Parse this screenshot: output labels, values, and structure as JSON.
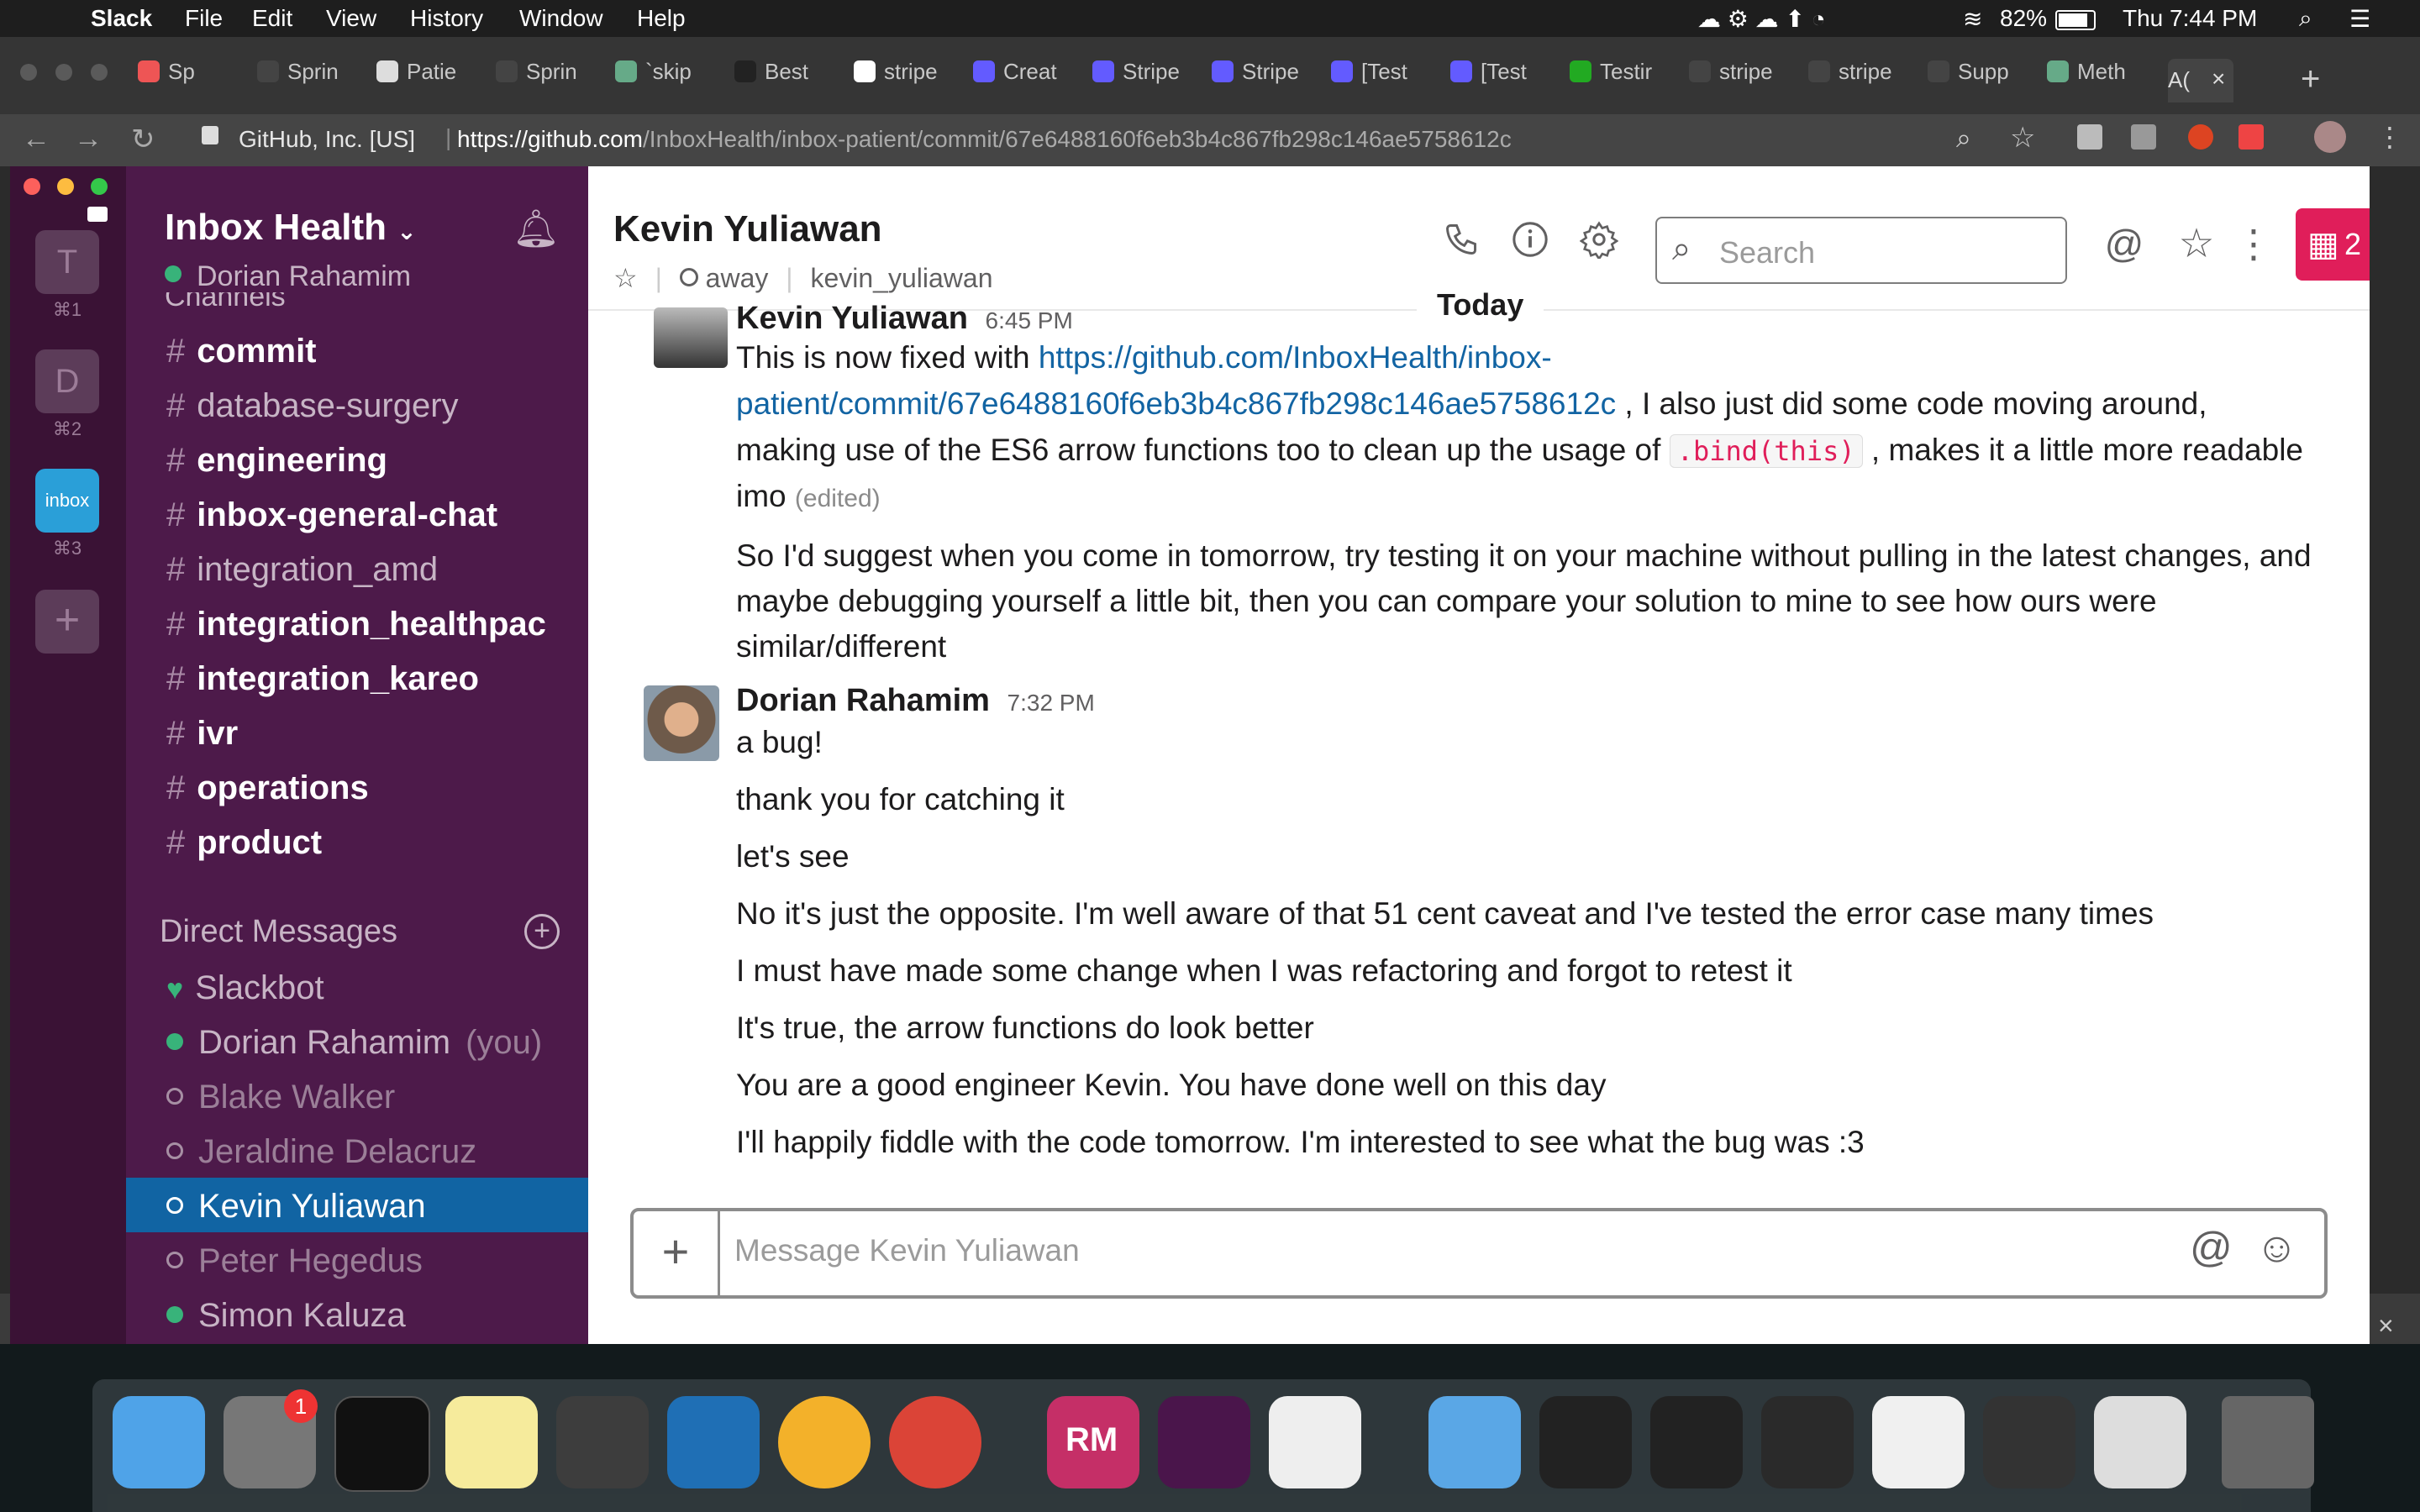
{
  "menubar": {
    "app": "Slack",
    "items": [
      "File",
      "Edit",
      "View",
      "History",
      "Window",
      "Help"
    ],
    "battery": "82%",
    "clock": "Thu 7:44 PM"
  },
  "browser": {
    "tabs": [
      "Sp",
      "Sprin",
      "Patie",
      "Sprin",
      "`skip",
      "Best",
      "stripe",
      "Creat",
      "Stripe",
      "Stripe",
      "[Test",
      "[Test",
      "Testir",
      "stripe",
      "stripe",
      "Supp",
      "Meth",
      "A("
    ],
    "site_identity": "GitHub, Inc. [US]",
    "url_host": "https://github.com",
    "url_path": "/InboxHealth/inbox-patient/commit/67e6488160f6eb3b4c867fb298c146ae5758612c"
  },
  "teams": [
    {
      "letter": "T",
      "shortcut": "⌘1"
    },
    {
      "letter": "D",
      "shortcut": "⌘2"
    },
    {
      "letter": "inbox",
      "shortcut": "⌘3"
    }
  ],
  "sidebar": {
    "workspace": "Inbox Health",
    "user": "Dorian Rahamim",
    "channels_header_partial": "Channels",
    "channels": [
      {
        "name": "commit",
        "bold": true
      },
      {
        "name": "database-surgery",
        "bold": false
      },
      {
        "name": "engineering",
        "bold": true
      },
      {
        "name": "inbox-general-chat",
        "bold": true
      },
      {
        "name": "integration_amd",
        "bold": false
      },
      {
        "name": "integration_healthpac",
        "bold": true
      },
      {
        "name": "integration_kareo",
        "bold": true
      },
      {
        "name": "ivr",
        "bold": true
      },
      {
        "name": "operations",
        "bold": true
      },
      {
        "name": "product",
        "bold": true
      }
    ],
    "dm_header": "Direct Messages",
    "dms": [
      {
        "name": "Slackbot",
        "status": "bot"
      },
      {
        "name": "Dorian Rahamim",
        "suffix": "(you)",
        "status": "online"
      },
      {
        "name": "Blake Walker",
        "status": "away"
      },
      {
        "name": "Jeraldine Delacruz",
        "status": "away"
      },
      {
        "name": "Kevin Yuliawan",
        "status": "away",
        "active": true
      },
      {
        "name": "Peter Hegedus",
        "status": "away"
      },
      {
        "name": "Simon Kaluza",
        "status": "online"
      }
    ]
  },
  "header": {
    "title": "Kevin Yuliawan",
    "status": "away",
    "handle": "kevin_yuliawan",
    "search_placeholder": "Search",
    "gift_count": "2"
  },
  "divider": "Today",
  "messages": {
    "kevin": {
      "author": "Kevin Yuliawan",
      "time": "6:45 PM",
      "l1_pre": "This is now fixed with ",
      "l1_link": "https://github.com/InboxHealth/inbox-",
      "l2_link": "patient/commit/67e6488160f6eb3b4c867fb298c146ae5758612c",
      "l2_post": " , I also just did some code moving around,",
      "l3_pre": "making use of the ES6 arrow functions too to clean up the usage of ",
      "l3_code": ".bind(this)",
      "l3_post": " , makes it a little more readable",
      "l4": "imo",
      "edited": "(edited)",
      "p2_l1": "So I'd suggest when you come in tomorrow, try testing it on your machine without pulling in the latest changes, and",
      "p2_l2": "maybe debugging yourself a little bit, then you can compare your solution to mine to see how ours were",
      "p2_l3": "similar/different"
    },
    "dorian": {
      "author": "Dorian Rahamim",
      "time": "7:32 PM",
      "lines": [
        "a bug!",
        "thank you for catching it",
        "let's see",
        "No it's just the opposite. I'm well aware of that 51 cent caveat and I've tested the error case many times",
        "I must have made some change when I was refactoring and forgot to retest it",
        "It's true, the arrow functions do look better",
        "You are a good engineer Kevin. You have done well on this day",
        "I'll happily fiddle with the code tomorrow. I'm interested to see what the bug was :3"
      ]
    }
  },
  "composer": {
    "placeholder": "Message Kevin Yuliawan"
  },
  "dock": {
    "badge_prefs": "1",
    "tooltip_rm": "RM"
  },
  "colors": {
    "sidebar": "#4d1a4a",
    "teams": "#3a1235",
    "active": "#1164a3",
    "online": "#38b37a",
    "gift": "#e01e5a"
  }
}
